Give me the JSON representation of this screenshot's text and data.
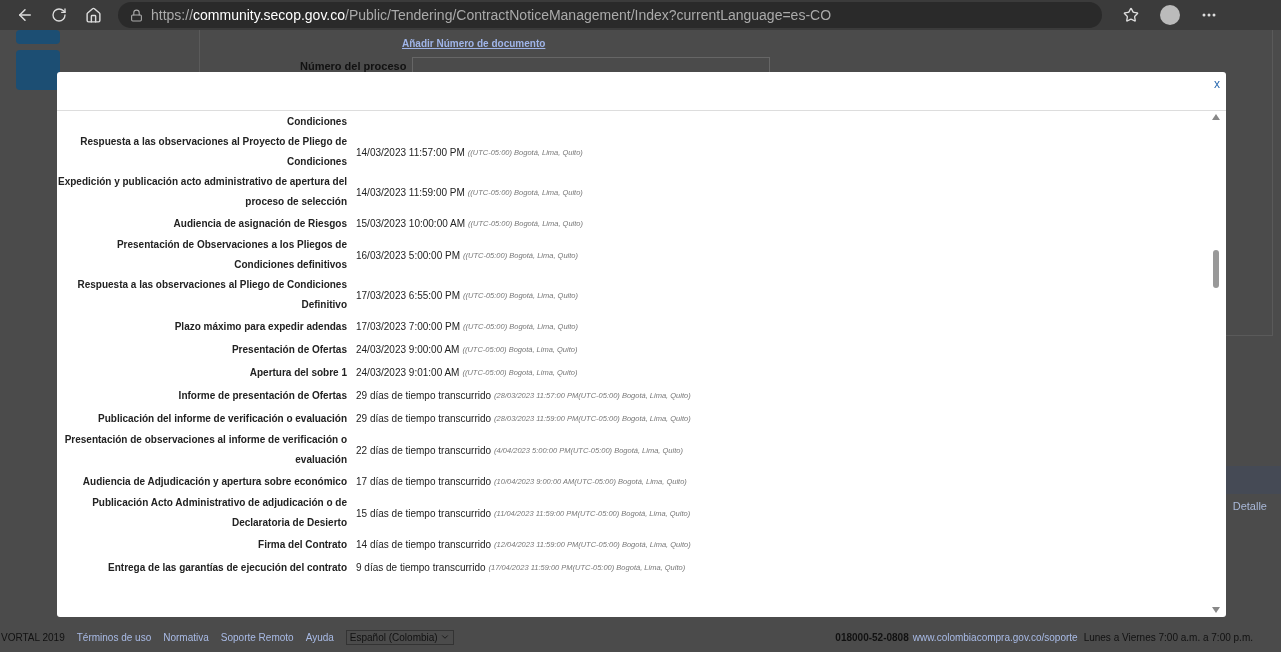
{
  "browser": {
    "url_scheme": "https://",
    "url_host": "community.secop.gov.co",
    "url_path": "/Public/Tendering/ContractNoticeManagement/Index?currentLanguage=es-CO"
  },
  "background": {
    "add_document_link": "Añadir Número de documento",
    "process_number_label": "Número del proceso",
    "detail_link": "Detalle"
  },
  "modal": {
    "close": "x",
    "rows": [
      {
        "label": "Condiciones"
      },
      {
        "label": "Respuesta a las observaciones al Proyecto de Pliego de Condiciones",
        "value": "14/03/2023 11:57:00 PM",
        "note": "((UTC-05:00) Bogotá, Lima, Quito)"
      },
      {
        "label": "Expedición y publicación acto administrativo de apertura del proceso de selección",
        "value": "14/03/2023 11:59:00 PM",
        "note": "((UTC-05:00) Bogotá, Lima, Quito)"
      },
      {
        "label": "Audiencia de asignación de Riesgos",
        "value": "15/03/2023 10:00:00 AM",
        "note": "((UTC-05:00) Bogotá, Lima, Quito)"
      },
      {
        "label": "Presentación de Observaciones a los Pliegos de Condiciones definitivos",
        "value": "16/03/2023 5:00:00 PM",
        "note": "((UTC-05:00) Bogotá, Lima, Quito)"
      },
      {
        "label": "Respuesta a las observaciones al Pliego de Condiciones Definitivo",
        "value": "17/03/2023 6:55:00 PM",
        "note": "((UTC-05:00) Bogotá, Lima, Quito)"
      },
      {
        "label": "Plazo máximo para expedir adendas",
        "value": "17/03/2023 7:00:00 PM",
        "note": "((UTC-05:00) Bogotá, Lima, Quito)"
      },
      {
        "label": "Presentación de Ofertas",
        "value": "24/03/2023 9:00:00 AM",
        "note": "((UTC-05:00) Bogotá, Lima, Quito)"
      },
      {
        "label": "Apertura del sobre 1",
        "value": "24/03/2023 9:01:00 AM",
        "note": "((UTC-05:00) Bogotá, Lima, Quito)"
      },
      {
        "label": "Informe de presentación de Ofertas",
        "value": "29 días de tiempo transcurrido",
        "note": "(28/03/2023 11:57:00 PM(UTC-05:00) Bogotá, Lima, Quito)"
      },
      {
        "label": "Publicación del informe de verificación o evaluación",
        "value": "29 días de tiempo transcurrido",
        "note": "(28/03/2023 11:59:00 PM(UTC-05:00) Bogotá, Lima, Quito)"
      },
      {
        "label": "Presentación de observaciones al informe de verificación o evaluación",
        "value": "22 días de tiempo transcurrido",
        "note": "(4/04/2023 5:00:00 PM(UTC-05:00) Bogotá, Lima, Quito)"
      },
      {
        "label": "Audiencia de Adjudicación y apertura sobre económico",
        "value": "17 días de tiempo transcurrido",
        "note": "(10/04/2023 9:00:00 AM(UTC-05:00) Bogotá, Lima, Quito)"
      },
      {
        "label": "Publicación Acto Administrativo de adjudicación o de Declaratoria de Desierto",
        "value": "15 días de tiempo transcurrido",
        "note": "(11/04/2023 11:59:00 PM(UTC-05:00) Bogotá, Lima, Quito)"
      },
      {
        "label": "Firma del Contrato",
        "value": "14 días de tiempo transcurrido",
        "note": "(12/04/2023 11:59:00 PM(UTC-05:00) Bogotá, Lima, Quito)"
      },
      {
        "label": "Entrega de las garantías de ejecución del contrato",
        "value": "9 días de tiempo transcurrido",
        "note": "(17/04/2023 11:59:00 PM(UTC-05:00) Bogotá, Lima, Quito)"
      }
    ]
  },
  "footer": {
    "copyright": "VORTAL 2019",
    "links": [
      "Términos de uso",
      "Normativa",
      "Soporte Remoto",
      "Ayuda"
    ],
    "language": "Español (Colombia)",
    "phone": "018000-52-0808",
    "support_link": "www.colombiacompra.gov.co/soporte",
    "hours": "Lunes a Viernes 7:00 a.m. a 7:00 p.m."
  }
}
